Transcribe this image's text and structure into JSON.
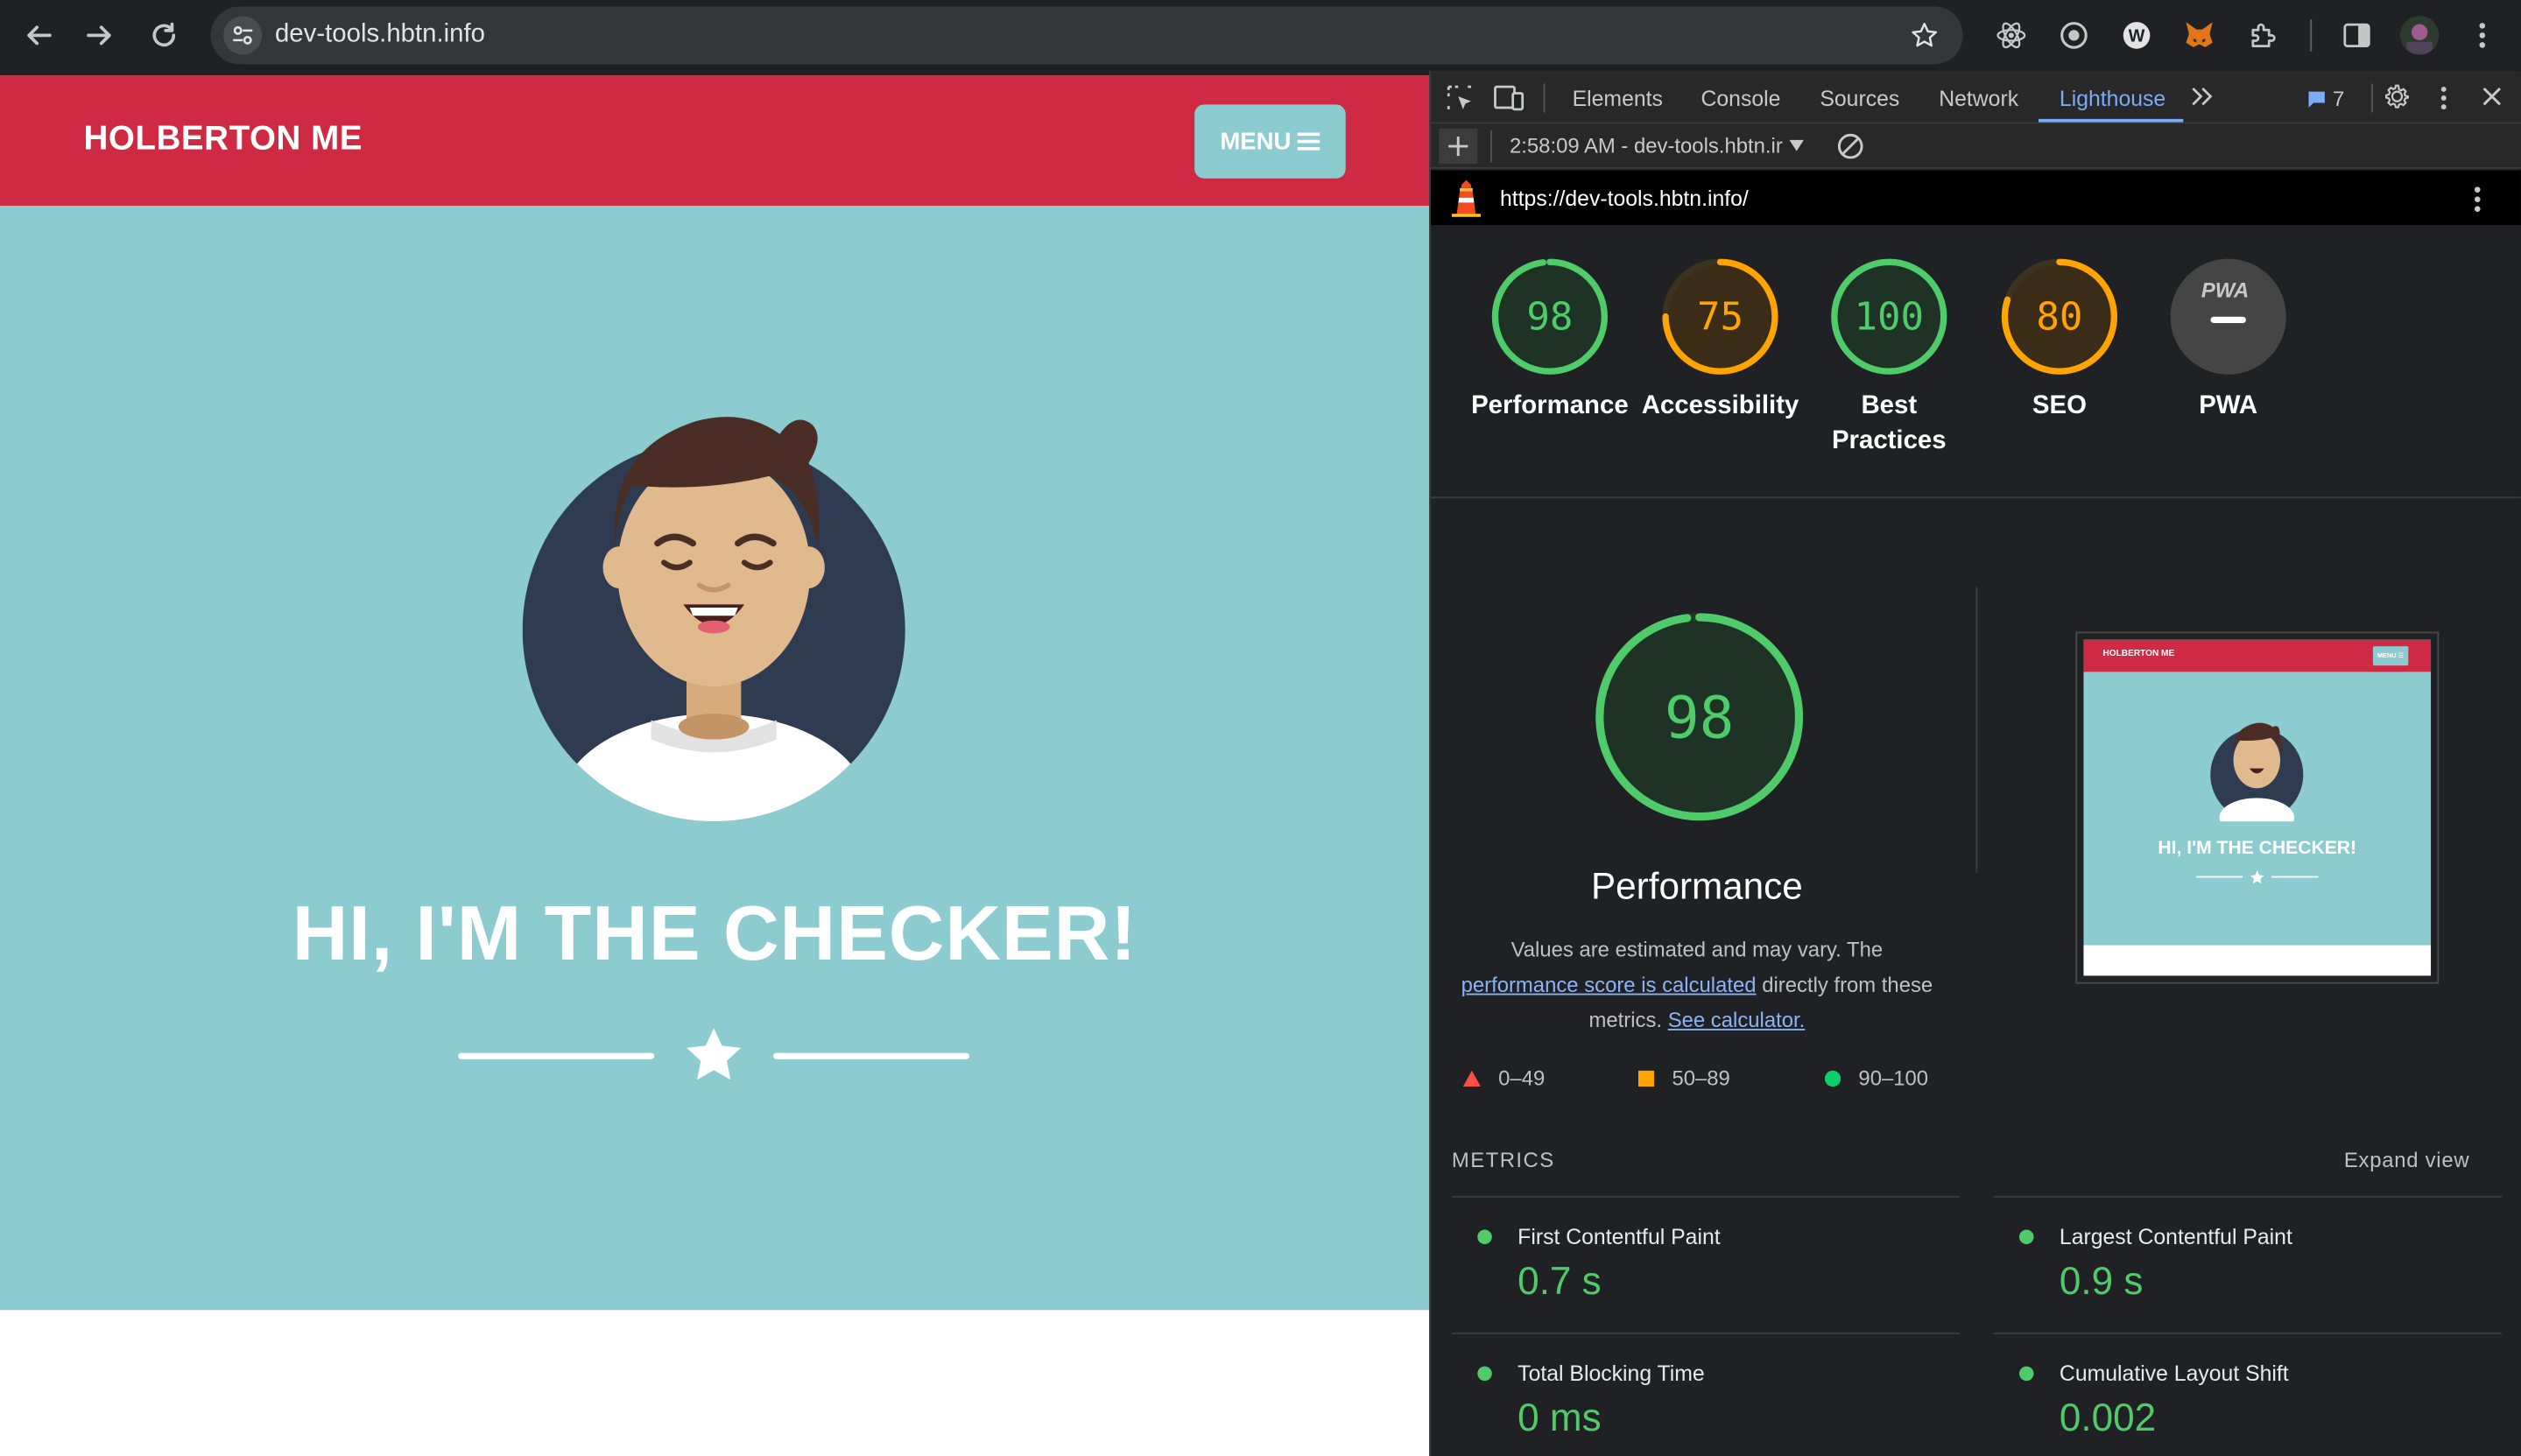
{
  "browser": {
    "url": "dev-tools.hbtn.info"
  },
  "site": {
    "brand": "HOLBERTON ME",
    "menu_label": "MENU",
    "hero_title": "HI, I'M THE CHECKER!"
  },
  "devtools": {
    "tabs": [
      "Elements",
      "Console",
      "Sources",
      "Network",
      "Lighthouse"
    ],
    "issues_count": "7",
    "report_selector": "2:58:09 AM - dev-tools.hbtn.ir",
    "report_url": "https://dev-tools.hbtn.info/"
  },
  "lighthouse": {
    "gauges": [
      {
        "label": "Performance",
        "score": "98",
        "value": 98,
        "status": "pass"
      },
      {
        "label": "Accessibility",
        "score": "75",
        "value": 75,
        "status": "average"
      },
      {
        "label": "Best Practices",
        "score": "100",
        "value": 100,
        "status": "pass"
      },
      {
        "label": "SEO",
        "score": "80",
        "value": 80,
        "status": "average"
      },
      {
        "label": "PWA",
        "score": "",
        "value": 0,
        "status": "na"
      }
    ],
    "pwa_badge": "PWA",
    "main": {
      "score": "98",
      "value": 98,
      "title": "Performance",
      "desc_prefix": "Values are estimated and may vary. The",
      "desc_link": "performance score is calculated",
      "desc_mid": "directly from these",
      "desc_tail": "metrics.",
      "calc_link": "See calculator."
    },
    "legend": [
      {
        "range": "0–49",
        "color": "#ff4e42",
        "shape": "triangle"
      },
      {
        "range": "50–89",
        "color": "#ffa400",
        "shape": "square"
      },
      {
        "range": "90–100",
        "color": "#0cce6b",
        "shape": "circle"
      }
    ],
    "thumbnail": {
      "brand": "HOLBERTON ME",
      "menu": "MENU ☰",
      "title": "HI, I'M THE CHECKER!"
    },
    "metrics_heading": "METRICS",
    "expand_label": "Expand view",
    "metrics": [
      {
        "label": "First Contentful Paint",
        "value": "0.7 s"
      },
      {
        "label": "Largest Contentful Paint",
        "value": "0.9 s"
      },
      {
        "label": "Total Blocking Time",
        "value": "0 ms"
      },
      {
        "label": "Cumulative Layout Shift",
        "value": "0.002"
      }
    ]
  },
  "colors": {
    "pass": "#4fcb6a",
    "average": "#ffa400",
    "fail": "#ff4e42",
    "brand_red": "#cf2a43",
    "hero_teal": "#8ccbd0"
  }
}
